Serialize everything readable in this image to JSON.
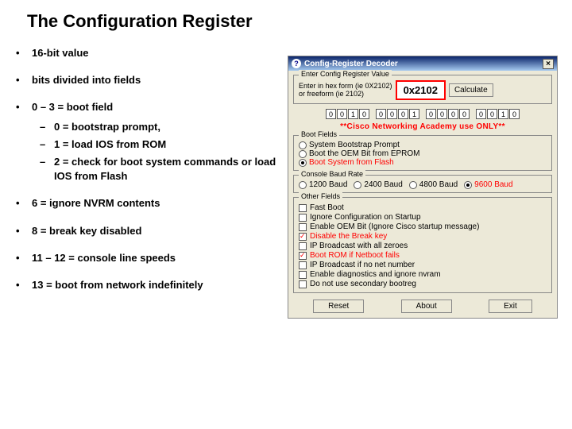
{
  "title": "The Configuration Register",
  "bullets": [
    "16-bit value",
    "bits divided into fields"
  ],
  "bul3": {
    "main": "0 – 3 = boot field",
    "subs": [
      "0 = bootstrap prompt,",
      "1 = load IOS from ROM",
      "2 = check for boot system commands or load IOS from Flash"
    ]
  },
  "bul4": "6 = ignore NVRM contents",
  "bul5": "8 = break key disabled",
  "bul6": "11 – 12 = console line speeds",
  "bul7": "13  = boot from network indefinitely",
  "decoder": {
    "windowTitle": "Config-Register Decoder",
    "grp1": {
      "title": "Enter Config Register Value",
      "hint1": "Enter in hex form (ie 0X2102)",
      "hint2": "or freeform (ie 2102)",
      "value": "0x2102",
      "calc": "Calculate"
    },
    "bits": [
      "0",
      "0",
      "1",
      "0",
      "0",
      "0",
      "0",
      "1",
      "0",
      "0",
      "0",
      "0",
      "0",
      "0",
      "1",
      "0"
    ],
    "warn": "**Cisco Networking Academy use ONLY**",
    "boot": {
      "title": "Boot Fields",
      "o1": "System Bootstrap Prompt",
      "o2": "Boot the OEM Bit from EPROM",
      "o3": "Boot System from Flash"
    },
    "baud": {
      "title": "Console Baud Rate",
      "o1": "1200 Baud",
      "o2": "2400 Baud",
      "o3": "4800 Baud",
      "o4": "9600 Baud"
    },
    "other": {
      "title": "Other Fields",
      "c1": "Fast Boot",
      "c2": "Ignore Configuration on Startup",
      "c3": "Enable OEM Bit (Ignore Cisco startup message)",
      "c4": "Disable the Break key",
      "c5": "IP Broadcast with all zeroes",
      "c6": "Boot ROM if Netboot fails",
      "c7": "IP Broadcast if no net number",
      "c8": "Enable diagnostics and ignore nvram",
      "c9": "Do not use secondary bootreg"
    },
    "buttons": {
      "reset": "Reset",
      "about": "About",
      "exit": "Exit"
    }
  }
}
